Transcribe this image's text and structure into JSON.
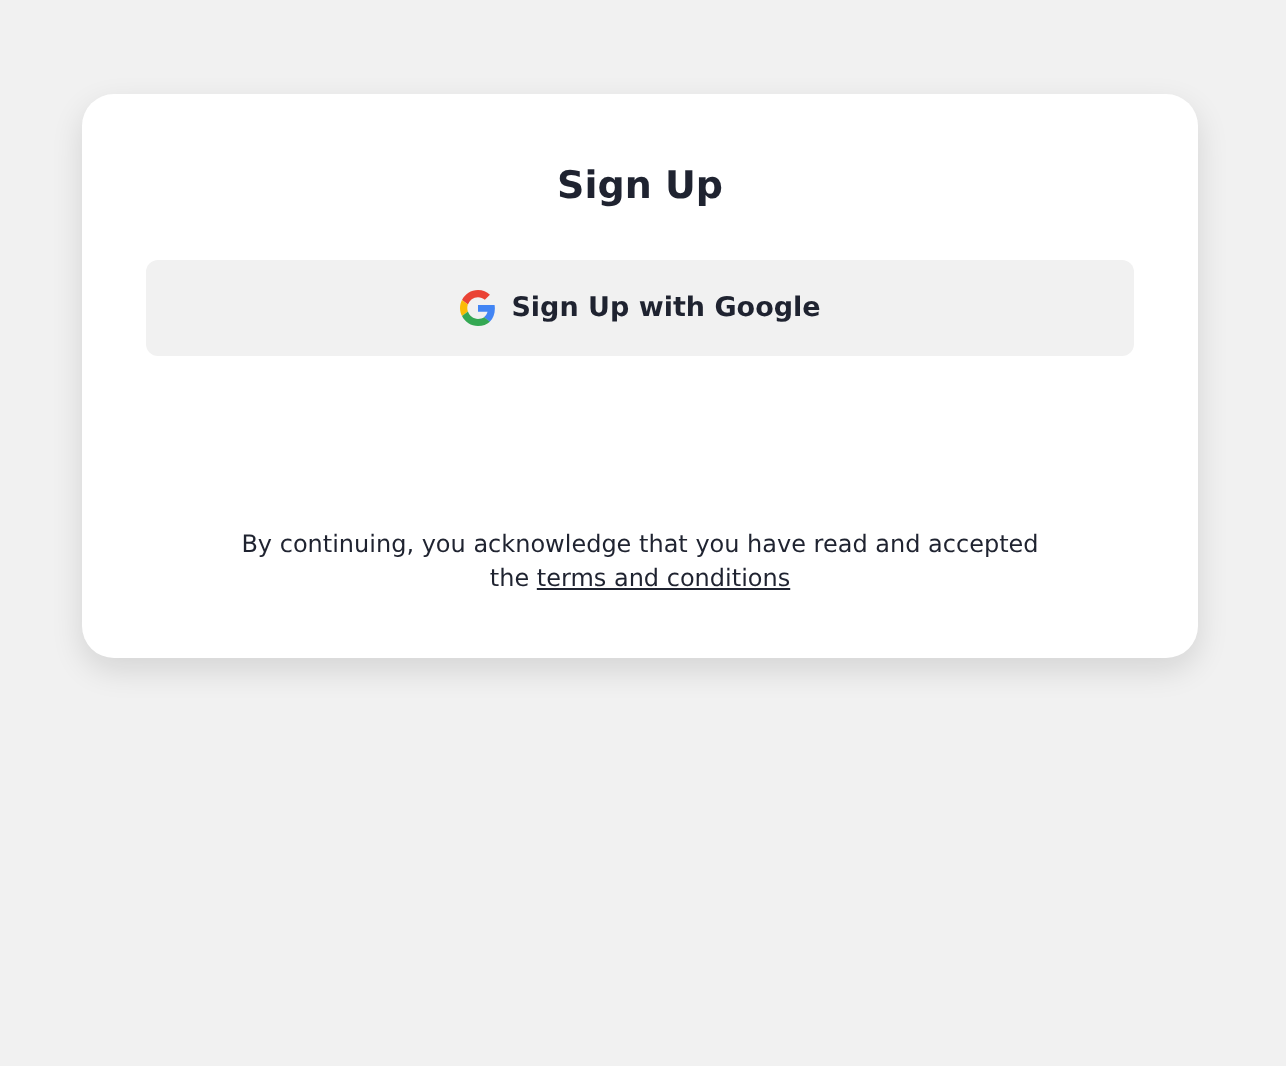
{
  "card": {
    "title": "Sign Up",
    "google_button": {
      "label": "Sign Up with Google"
    },
    "notice": {
      "text": "By continuing, you acknowledge that you have read and accepted the",
      "link": "terms and conditions"
    }
  }
}
